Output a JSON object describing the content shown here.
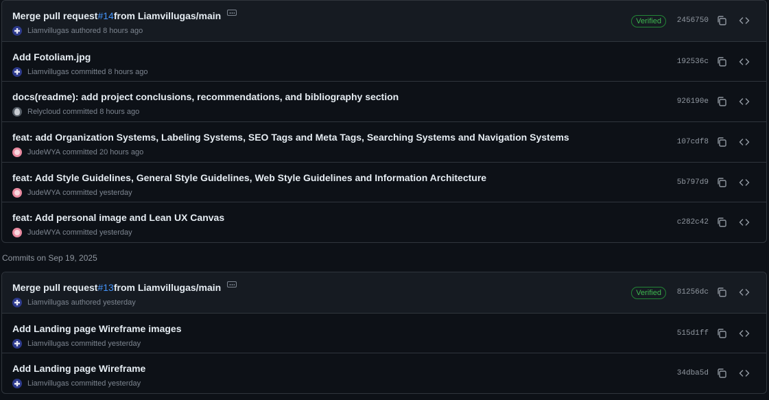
{
  "section_label": "Commits on Sep 19, 2025",
  "verified_label": "Verified",
  "group1": [
    {
      "title_prefix": "Merge pull request ",
      "pr": "#14",
      "title_suffix": " from Liamvillugas/main",
      "author": "Liamvillugas",
      "action": "authored",
      "time": "8 hours ago",
      "sha": "2456750",
      "verified": true,
      "avatar": "liam"
    },
    {
      "title": "Add Fotoliam.jpg",
      "author": "Liamvillugas",
      "action": "committed",
      "time": "8 hours ago",
      "sha": "192536c",
      "avatar": "liam"
    },
    {
      "title": "docs(readme): add project conclusions, recommendations, and bibliography section",
      "author": "Relycloud",
      "action": "committed",
      "time": "8 hours ago",
      "sha": "926190e",
      "avatar": "rely"
    },
    {
      "title": "feat: add Organization Systems, Labeling Systems, SEO Tags and Meta Tags, Searching Systems and Navigation Systems",
      "author": "JudeWYA",
      "action": "committed",
      "time": "20 hours ago",
      "sha": "107cdf8",
      "avatar": "jude"
    },
    {
      "title": "feat: Add Style Guidelines, General Style Guidelines, Web Style Guidelines and Information Architecture",
      "author": "JudeWYA",
      "action": "committed",
      "time": "yesterday",
      "sha": "5b797d9",
      "avatar": "jude"
    },
    {
      "title": "feat: Add personal image and Lean UX Canvas",
      "author": "JudeWYA",
      "action": "committed",
      "time": "yesterday",
      "sha": "c282c42",
      "avatar": "jude"
    }
  ],
  "group2": [
    {
      "title_prefix": "Merge pull request ",
      "pr": "#13",
      "title_suffix": " from Liamvillugas/main",
      "author": "Liamvillugas",
      "action": "authored",
      "time": "yesterday",
      "sha": "81256dc",
      "verified": true,
      "avatar": "liam"
    },
    {
      "title": "Add Landing page Wireframe images",
      "author": "Liamvillugas",
      "action": "committed",
      "time": "yesterday",
      "sha": "515d1ff",
      "avatar": "liam"
    },
    {
      "title": "Add Landing page Wireframe",
      "author": "Liamvillugas",
      "action": "committed",
      "time": "yesterday",
      "sha": "34dba5d",
      "avatar": "liam"
    }
  ]
}
